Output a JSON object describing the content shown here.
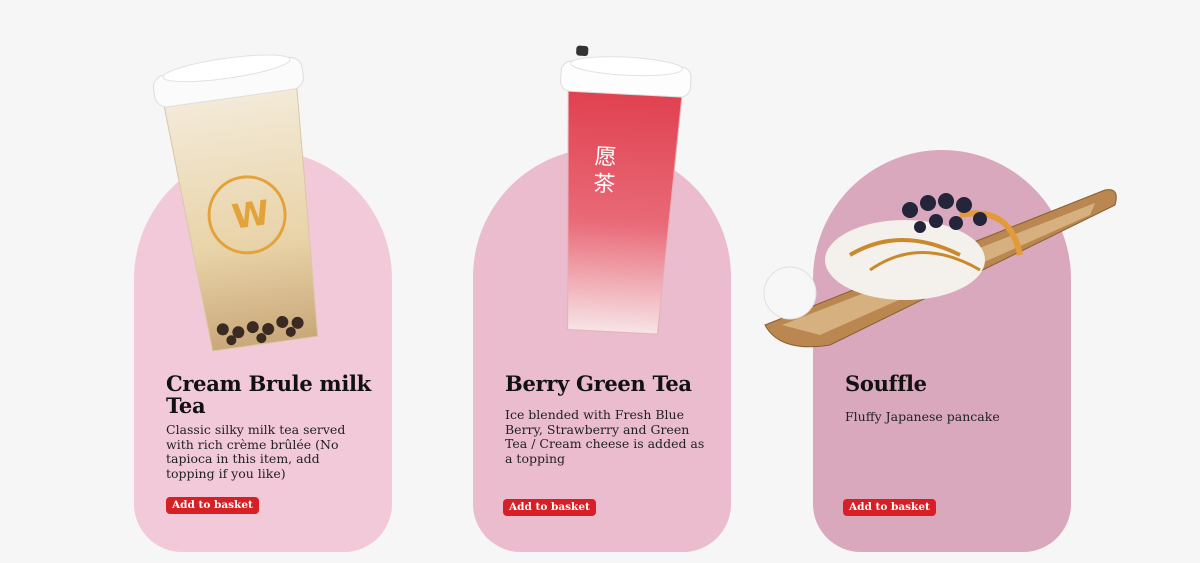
{
  "products": [
    {
      "title": "Cream Brule milk Tea",
      "description": "Classic silky milk tea served with rich crème brûlée (No tapioca in this item, add topping if you like)",
      "button_label": "Add to basket",
      "card_color": "#f2c9d8"
    },
    {
      "title": "Berry Green Tea",
      "description": "Ice blended with Fresh Blue Berry, Strawberry and Green Tea / Cream cheese is added as a topping",
      "button_label": "Add to basket",
      "card_color": "#eabccd"
    },
    {
      "title": "Souffle",
      "description": "Fluffy Japanese pancake",
      "button_label": "Add to basket",
      "card_color": "#d9a8bd"
    }
  ],
  "colors": {
    "accent": "#d71f26",
    "background": "#f6f6f6"
  },
  "icons": {
    "cup1": "milk-tea-cup-image",
    "cup2": "berry-tea-cup-image",
    "dessert": "souffle-plate-image"
  }
}
